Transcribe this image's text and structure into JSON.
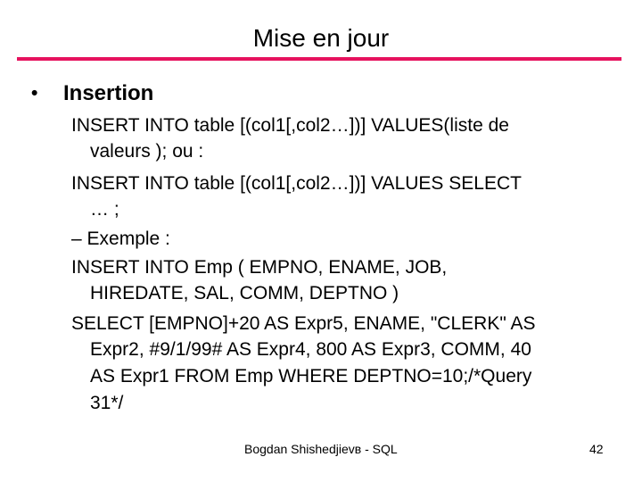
{
  "slide": {
    "title": "Mise en jour",
    "accent_color": "#e6125e",
    "bullet_glyph": "•",
    "heading": "Insertion",
    "lines": [
      "INSERT INTO table [(col1[,col2…])] VALUES(liste de",
      "valeurs ); ou :",
      "INSERT INTO table [(col1[,col2…])] VALUES SELECT",
      "… ;",
      "– Exemple :",
      "INSERT INTO Emp ( EMPNO, ENAME, JOB,",
      "HIREDATE, SAL, COMM, DEPTNO )",
      "SELECT [EMPNO]+20 AS Expr5, ENAME, \"CLERK\" AS",
      "Expr2, #9/1/99# AS Expr4, 800 AS Expr3, COMM, 40",
      "AS Expr1 FROM Emp WHERE DEPTNO=10;/*Query",
      "31*/"
    ]
  },
  "footer": {
    "author": "Bogdan Shishedjievв - SQL",
    "page_number": "42"
  }
}
